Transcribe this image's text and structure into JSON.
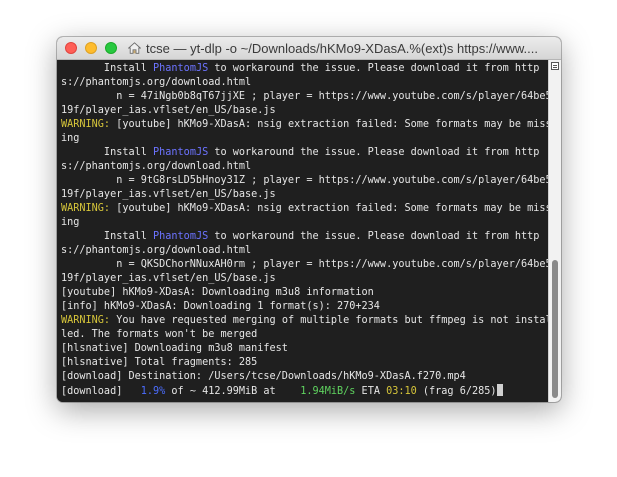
{
  "window": {
    "title": "tcse — yt-dlp -o ~/Downloads/hKMo9-XDasA.%(ext)s https://www...."
  },
  "icons": {
    "title": "home-folder-icon",
    "scroll_menu": "scrollback-menu-icon"
  },
  "colors": {
    "warning": "#d6c53a",
    "link": "#6c73ff",
    "percent": "#4b6dff",
    "speed": "#5fd35f"
  },
  "terminal": {
    "block1": {
      "install": "       Install ",
      "phantom": "PhantomJS",
      "rest": " to workaround the issue. Please download it from http",
      "url": "s://phantomjs.org/download.html",
      "n_line": "         n = 47iNgb0b8qT67jjXE ; player = https://www.youtube.com/s/player/64be5",
      "player": "19f/player_ias.vflset/en_US/base.js"
    },
    "warn1": {
      "label": "WARNING:",
      "text": " [youtube] hKMo9-XDasA: nsig extraction failed: Some formats may be miss",
      "cont": "ing"
    },
    "block2": {
      "install": "       Install ",
      "phantom": "PhantomJS",
      "rest": " to workaround the issue. Please download it from http",
      "url": "s://phantomjs.org/download.html",
      "n_line": "         n = 9tG8rsLD5bHnoy31Z ; player = https://www.youtube.com/s/player/64be5",
      "player": "19f/player_ias.vflset/en_US/base.js"
    },
    "warn2": {
      "label": "WARNING:",
      "text": " [youtube] hKMo9-XDasA: nsig extraction failed: Some formats may be miss",
      "cont": "ing"
    },
    "block3": {
      "install": "       Install ",
      "phantom": "PhantomJS",
      "rest": " to workaround the issue. Please download it from http",
      "url": "s://phantomjs.org/download.html",
      "n_line": "         n = QKSDChorNNuxAH0rm ; player = https://www.youtube.com/s/player/64be5",
      "player": "19f/player_ias.vflset/en_US/base.js"
    },
    "youtube_m3u8": "[youtube] hKMo9-XDasA: Downloading m3u8 information",
    "info_format": "[info] hKMo9-XDasA: Downloading 1 format(s): 270+234",
    "warn3": {
      "label": "WARNING:",
      "text": " You have requested merging of multiple formats but ffmpeg is not instal",
      "cont": "led. The formats won't be merged"
    },
    "hls_manifest": "[hlsnative] Downloading m3u8 manifest",
    "hls_fragments": "[hlsnative] Total fragments: 285",
    "destination": "[download] Destination: /Users/tcse/Downloads/hKMo9-XDasA.f270.mp4",
    "progress": {
      "prefix": "[download]   ",
      "percent": "1.9%",
      "of": " of ~ 412.99MiB at    ",
      "speed": "1.94MiB/s",
      "eta_label": " ETA ",
      "eta": "03:10",
      "frag": " (frag 6/285)"
    }
  }
}
